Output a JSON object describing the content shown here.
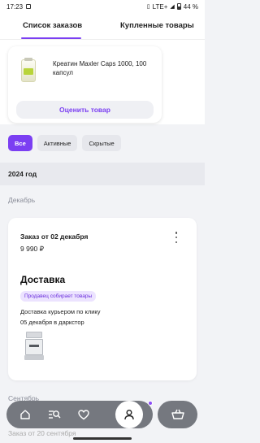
{
  "status_bar": {
    "time": "17:23",
    "network": "LTE+",
    "battery": "44 %",
    "battery_level": 0.44
  },
  "tabs": {
    "orders": "Список заказов",
    "bought": "Купленные товары"
  },
  "rate_card": {
    "product_name": "Креатин Maxler Caps 1000, 100 капсул",
    "button": "Оценить товар"
  },
  "filters": [
    "Все",
    "Активные",
    "Скрытые"
  ],
  "year": "2024 год",
  "months": {
    "december": "Декабрь",
    "september": "Сентябрь"
  },
  "order": {
    "title": "Заказ от 02 декабря",
    "sum": "9 990 ₽",
    "delivery_heading": "Доставка",
    "status": "Продавец собирает товары",
    "method": "Доставка курьером по клику",
    "date": "05 декабря в даркстор"
  },
  "next_order_peek": "Заказ от 20 сентября",
  "colors": {
    "accent": "#7b3ff2",
    "badge_bg": "#ece3ff",
    "nav_bg": "#75787f"
  },
  "icons": {
    "home": "home-icon",
    "catalog": "catalog-search-icon",
    "favorites": "heart-icon",
    "profile": "profile-icon",
    "cart": "cart-icon",
    "more": "more-vertical-icon"
  }
}
